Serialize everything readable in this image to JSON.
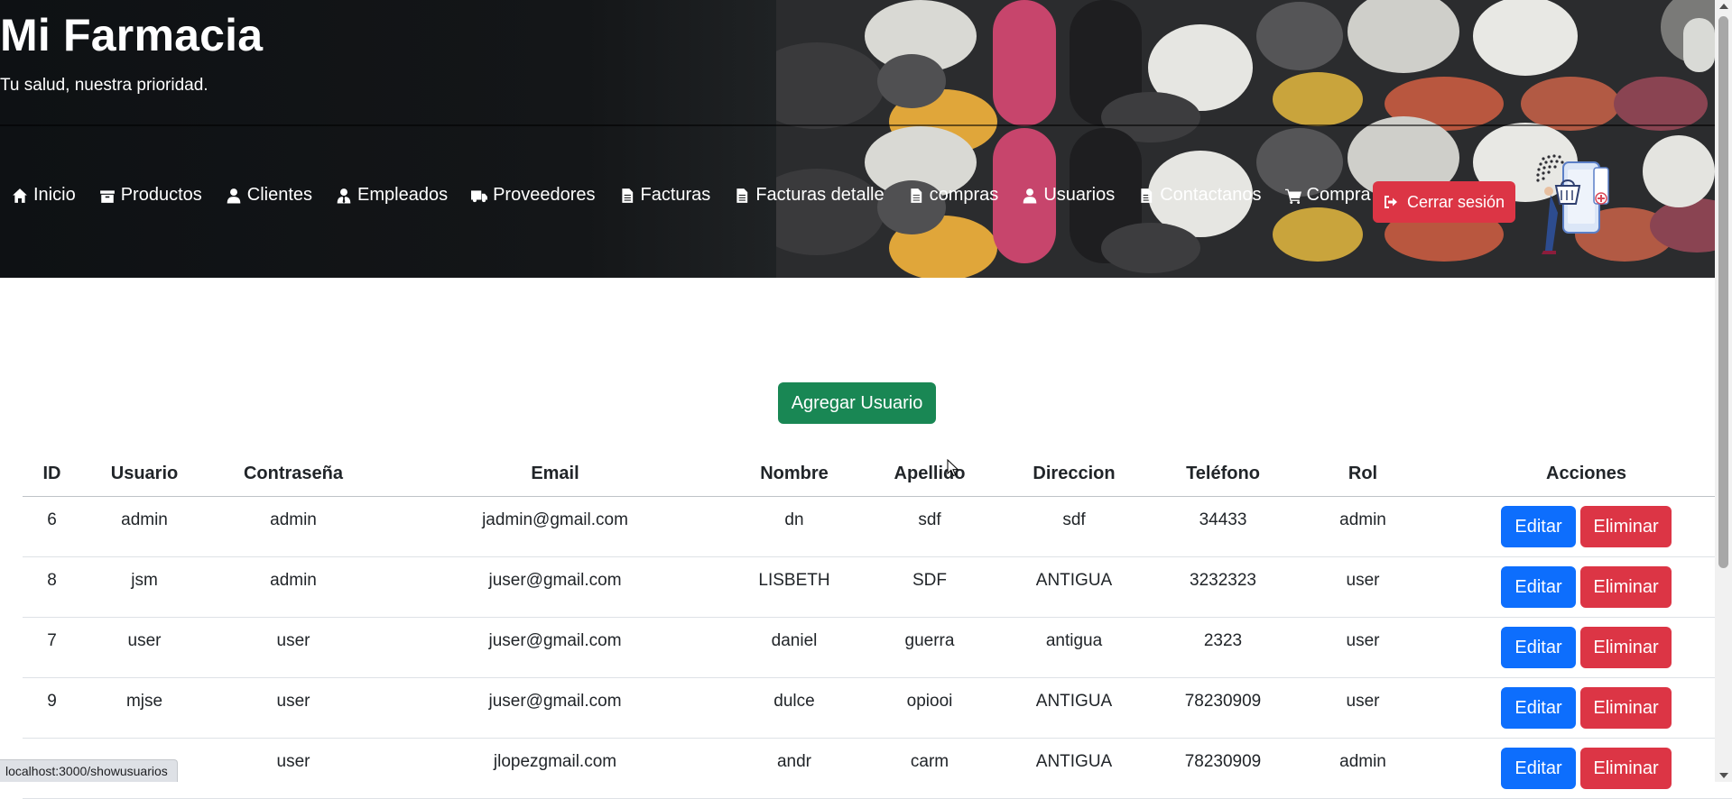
{
  "header": {
    "title": "Mi Farmacia",
    "subtitle": "Tu salud, nuestra prioridad."
  },
  "nav": [
    {
      "label": "Inicio",
      "icon": "home-icon"
    },
    {
      "label": "Productos",
      "icon": "box-icon"
    },
    {
      "label": "Clientes",
      "icon": "user-icon"
    },
    {
      "label": "Empleados",
      "icon": "user-tie-icon"
    },
    {
      "label": "Proveedores",
      "icon": "truck-icon"
    },
    {
      "label": "Facturas",
      "icon": "file-icon"
    },
    {
      "label": "Facturas detalle",
      "icon": "file-icon"
    },
    {
      "label": "compras",
      "icon": "file-icon"
    },
    {
      "label": "Usuarios",
      "icon": "user-icon"
    },
    {
      "label": "Contactanos",
      "icon": "file-icon"
    },
    {
      "label": "Compra",
      "icon": "cart-icon"
    }
  ],
  "logout": {
    "label": "Cerrar sesión",
    "icon": "sign-out-icon"
  },
  "main": {
    "add_button": "Agregar Usuario"
  },
  "table": {
    "headers": [
      "ID",
      "Usuario",
      "Contraseña",
      "Email",
      "Nombre",
      "Apellido",
      "Direccion",
      "Teléfono",
      "Rol",
      "Acciones"
    ],
    "rows": [
      {
        "id": "6",
        "usuario": "admin",
        "contrasena": "admin",
        "email": "jadmin@gmail.com",
        "nombre": "dn",
        "apellido": "sdf",
        "direccion": "sdf",
        "telefono": "34433",
        "rol": "admin"
      },
      {
        "id": "8",
        "usuario": "jsm",
        "contrasena": "admin",
        "email": "juser@gmail.com",
        "nombre": "LISBETH",
        "apellido": "SDF",
        "direccion": "ANTIGUA",
        "telefono": "3232323",
        "rol": "user"
      },
      {
        "id": "7",
        "usuario": "user",
        "contrasena": "user",
        "email": "juser@gmail.com",
        "nombre": "daniel",
        "apellido": "guerra",
        "direccion": "antigua",
        "telefono": "2323",
        "rol": "user"
      },
      {
        "id": "9",
        "usuario": "mjse",
        "contrasena": "user",
        "email": "juser@gmail.com",
        "nombre": "dulce",
        "apellido": "opiooi",
        "direccion": "ANTIGUA",
        "telefono": "78230909",
        "rol": "user"
      },
      {
        "id": "",
        "usuario": "",
        "contrasena": "user",
        "email": "jlopezgmail.com",
        "nombre": "andr",
        "apellido": "carm",
        "direccion": "ANTIGUA",
        "telefono": "78230909",
        "rol": "admin"
      }
    ],
    "edit_label": "Editar",
    "delete_label": "Eliminar"
  },
  "status_bar": {
    "url": "localhost:3000/showusuarios"
  },
  "colors": {
    "primary": "#0d6efd",
    "danger": "#dc3545",
    "success": "#198754",
    "header_bg": "#121212"
  }
}
